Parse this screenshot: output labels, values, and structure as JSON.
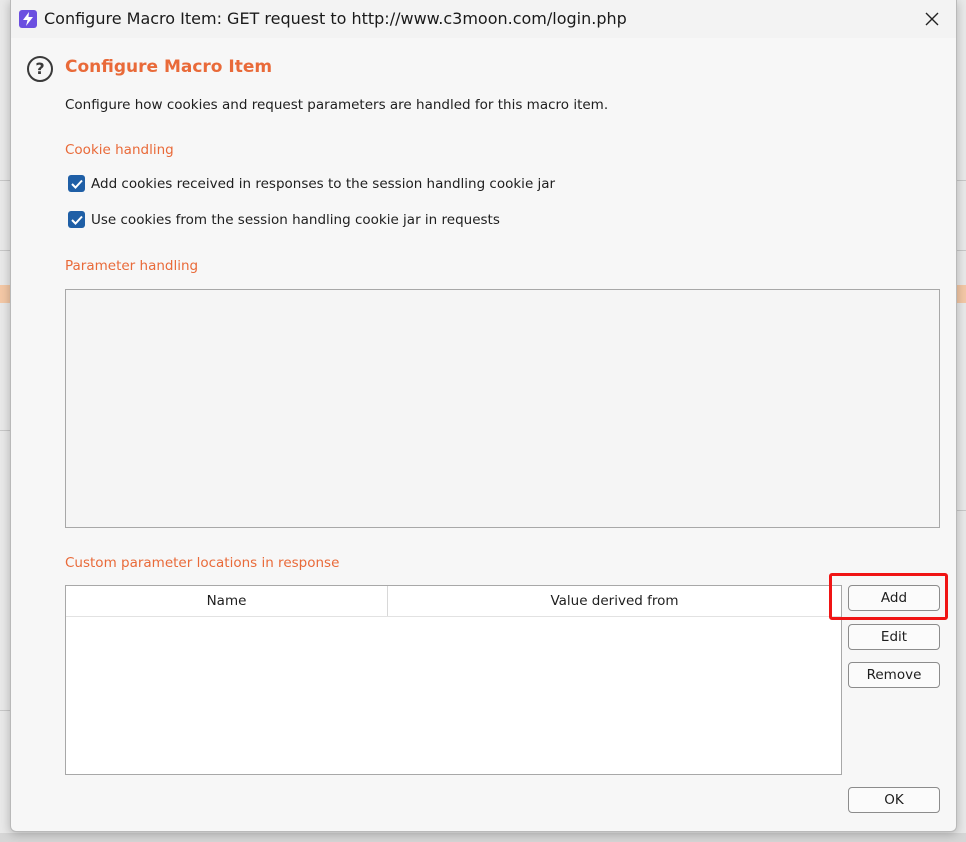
{
  "window": {
    "title": "Configure Macro Item: GET request to http://www.c3moon.com/login.php"
  },
  "dialog": {
    "heading": "Configure Macro Item",
    "description": "Configure how cookies and request parameters are handled for this macro item.",
    "cookie_section": {
      "title": "Cookie handling",
      "options": [
        {
          "label": "Add cookies received in responses to the session handling cookie jar",
          "checked": true
        },
        {
          "label": "Use cookies from the session handling cookie jar in requests",
          "checked": true
        }
      ]
    },
    "parameter_section": {
      "title": "Parameter handling"
    },
    "custom_section": {
      "title": "Custom parameter locations in response",
      "columns": [
        "Name",
        "Value derived from"
      ],
      "rows": []
    },
    "buttons": {
      "add": "Add",
      "edit": "Edit",
      "remove": "Remove",
      "ok": "OK"
    }
  },
  "colors": {
    "accent": "#e96a39",
    "checkbox": "#1f5fa6",
    "highlight": "#f01414"
  }
}
